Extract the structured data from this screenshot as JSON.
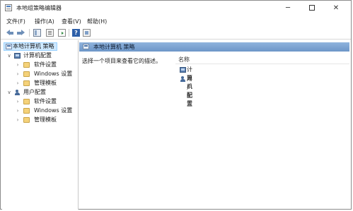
{
  "window": {
    "title": "本地组策略编辑器"
  },
  "menu": [
    "文件(F)",
    "操作(A)",
    "查看(V)",
    "帮助(H)"
  ],
  "toolbar": {
    "help_label": "?"
  },
  "tree": {
    "root": "本地计算机 策略",
    "computer_config": "计算机配置",
    "computer_children": [
      "软件设置",
      "Windows 设置",
      "管理模板"
    ],
    "user_config": "用户配置",
    "user_children": [
      "软件设置",
      "Windows 设置",
      "管理模板"
    ]
  },
  "right": {
    "header": "本地计算机 策略",
    "description": "选择一个项目来查看它的描述。",
    "column_name": "名称",
    "items": [
      "计算机配置",
      "用户配置"
    ]
  },
  "window_controls": {
    "minimize": "─",
    "close": "✕"
  }
}
